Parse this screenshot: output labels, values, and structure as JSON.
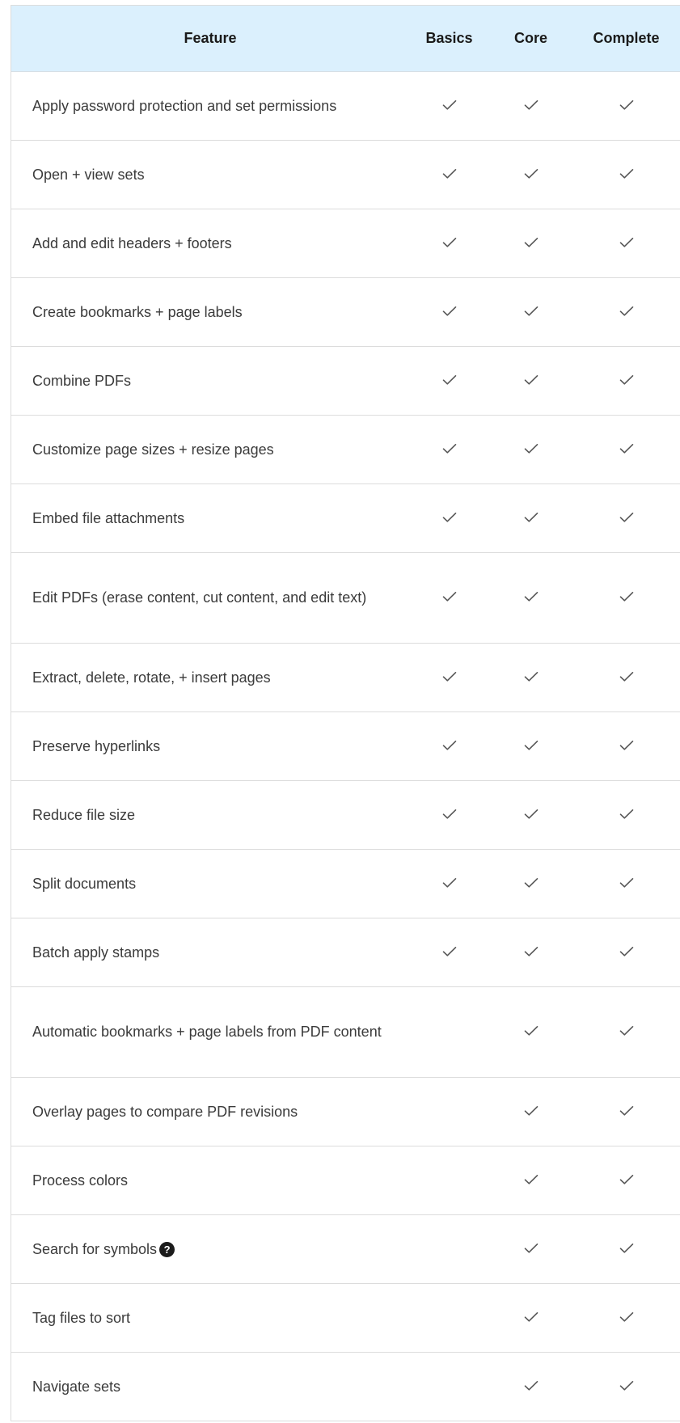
{
  "header": {
    "feature": "Feature",
    "basics": "Basics",
    "core": "Core",
    "complete": "Complete"
  },
  "rows": [
    {
      "feature": "Apply password protection and set permissions",
      "basics": true,
      "core": true,
      "complete": true
    },
    {
      "feature": "Open + view sets",
      "basics": true,
      "core": true,
      "complete": true
    },
    {
      "feature": "Add and edit headers + footers",
      "basics": true,
      "core": true,
      "complete": true
    },
    {
      "feature": "Create bookmarks + page labels",
      "basics": true,
      "core": true,
      "complete": true
    },
    {
      "feature": "Combine PDFs",
      "basics": true,
      "core": true,
      "complete": true
    },
    {
      "feature": "Customize page sizes + resize pages",
      "basics": true,
      "core": true,
      "complete": true
    },
    {
      "feature": "Embed file attachments",
      "basics": true,
      "core": true,
      "complete": true
    },
    {
      "feature": "Edit PDFs (erase content, cut content, and edit text)",
      "basics": true,
      "core": true,
      "complete": true
    },
    {
      "feature": "Extract, delete, rotate, + insert pages",
      "basics": true,
      "core": true,
      "complete": true
    },
    {
      "feature": "Preserve hyperlinks",
      "basics": true,
      "core": true,
      "complete": true
    },
    {
      "feature": "Reduce file size",
      "basics": true,
      "core": true,
      "complete": true
    },
    {
      "feature": "Split documents",
      "basics": true,
      "core": true,
      "complete": true
    },
    {
      "feature": "Batch apply stamps",
      "basics": true,
      "core": true,
      "complete": true
    },
    {
      "feature": "Automatic bookmarks + page labels from PDF content",
      "basics": false,
      "core": true,
      "complete": true
    },
    {
      "feature": "Overlay pages to compare PDF revisions",
      "basics": false,
      "core": true,
      "complete": true
    },
    {
      "feature": "Process colors",
      "basics": false,
      "core": true,
      "complete": true
    },
    {
      "feature": "Search for symbols",
      "basics": false,
      "core": true,
      "complete": true,
      "help_icon": "question-circle-icon"
    },
    {
      "feature": "Tag files to sort",
      "basics": false,
      "core": true,
      "complete": true
    },
    {
      "feature": "Navigate sets",
      "basics": false,
      "core": true,
      "complete": true
    }
  ],
  "colors": {
    "header_bg": "#dbf0fd",
    "border": "#dcdcdc",
    "check": "#555555"
  }
}
